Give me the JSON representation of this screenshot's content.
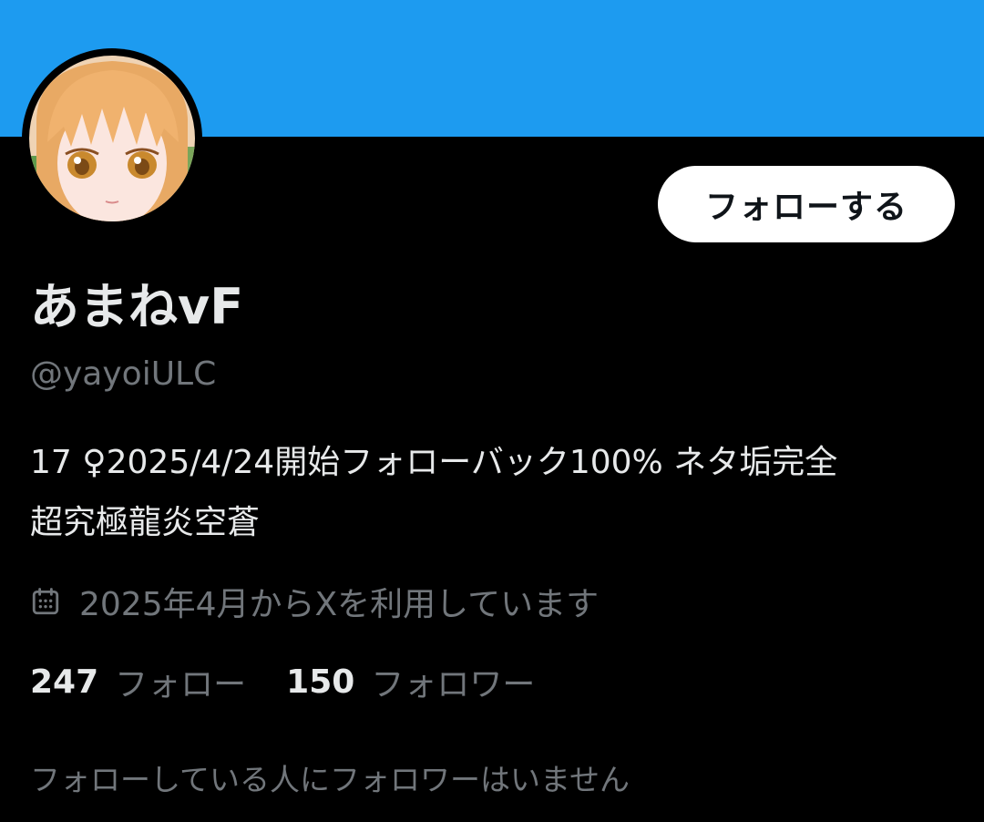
{
  "colors": {
    "banner": "#1d9bf0",
    "background": "#000000",
    "primary_text": "#e7e9ea",
    "secondary_text": "#71767b",
    "button_bg": "#ffffff",
    "button_text": "#0f1419"
  },
  "profile": {
    "display_name": "あまねvF",
    "handle": "@yayoiULC",
    "bio_line1": "17 ♀2025/4/24開始フォローバック100% ネタ垢完全",
    "bio_line2": "超究極龍炎空蒼",
    "joined_icon": "calendar-icon",
    "joined": "2025年4月からXを利用しています",
    "avatar_icon": "avatar-anime-girl"
  },
  "actions": {
    "follow_label": "フォローする"
  },
  "stats": {
    "following_count": "247",
    "following_label": "フォロー",
    "followers_count": "150",
    "followers_label": "フォロワー"
  },
  "mutuals": {
    "text": "フォローしている人にフォロワーはいません"
  }
}
